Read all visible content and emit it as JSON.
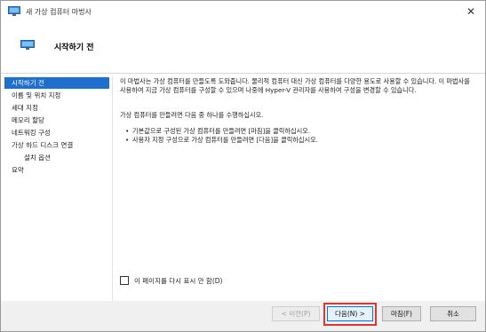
{
  "window": {
    "title": "새 가상 컴퓨터 마법사",
    "close_glyph": "✕"
  },
  "header": {
    "title": "시작하기 전",
    "icon": "monitor-icon"
  },
  "nav": {
    "items": [
      {
        "label": "시작하기 전",
        "active": true
      },
      {
        "label": "이름 및 위치 지정"
      },
      {
        "label": "세대 지정"
      },
      {
        "label": "메모리 할당"
      },
      {
        "label": "네트워킹 구성"
      },
      {
        "label": "가상 하드 디스크 연결"
      },
      {
        "label": "설치 옵션",
        "sub": true
      },
      {
        "label": "요약"
      }
    ]
  },
  "content": {
    "paragraph1": "이 마법사는 가상 컴퓨터를 만들도록 도와줍니다. 물리적 컴퓨터 대신 가상 컴퓨터를 다양한 용도로 사용할 수 있습니다. 이 마법사를 사용하여 지금 가상 컴퓨터를 구성할 수 있으며 나중에 Hyper-V 관리자를 사용하여 구성을 변경할 수 있습니다.",
    "paragraph2": "가상 컴퓨터를 만들려면 다음 중 하나를 수행하십시오.",
    "bullet1": "기본값으로 구성된 가상 컴퓨터를 만들려면 [마침]을 클릭하십시오.",
    "bullet2": "사용자 지정 구성으로 가상 컴퓨터를 만들려면 [다음]을 클릭하십시오."
  },
  "checkbox": {
    "label": "이 페이지를 다시 표시 안 함(D)",
    "checked": false
  },
  "buttons": {
    "prev": "< 이전(P)",
    "next": "다음(N) >",
    "finish": "마침(F)",
    "cancel": "취소"
  },
  "colors": {
    "accent": "#1f6fce",
    "highlight": "#e03333"
  }
}
